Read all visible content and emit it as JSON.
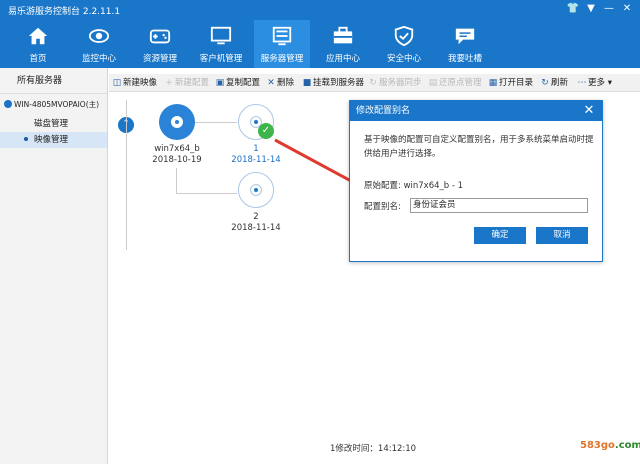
{
  "window": {
    "title": "易乐游服务控制台 2.2.11.1"
  },
  "nav": {
    "items": [
      {
        "label": "首页",
        "icon": "home-icon"
      },
      {
        "label": "监控中心",
        "icon": "eye-icon"
      },
      {
        "label": "资源管理",
        "icon": "gamepad-icon"
      },
      {
        "label": "客户机管理",
        "icon": "monitor-icon"
      },
      {
        "label": "服务器管理",
        "icon": "server-icon"
      },
      {
        "label": "应用中心",
        "icon": "toolbox-icon"
      },
      {
        "label": "安全中心",
        "icon": "shield-icon"
      },
      {
        "label": "我要吐槽",
        "icon": "chat-icon"
      }
    ],
    "active_index": 4
  },
  "sidebar": {
    "header": "所有服务器",
    "server": "WIN-4805MVOPAIO(主)",
    "items": [
      "磁盘管理",
      "映像管理"
    ],
    "selected": "映像管理"
  },
  "toolbar": {
    "new_image": "新建映像",
    "new_config": "新建配置",
    "copy_config": "复制配置",
    "delete": "删除",
    "mount": "挂载到服务器",
    "sync": "服务器同步",
    "restore_point": "还原点管理",
    "open_dir": "打开目录",
    "refresh": "刷新",
    "more": "更多"
  },
  "tree": {
    "root": {
      "name": "win7x64_b",
      "date": "2018-10-19"
    },
    "config1": {
      "name": "1",
      "date": "2018-11-14"
    },
    "config2": {
      "name": "2",
      "date": "2018-11-14"
    }
  },
  "dialog": {
    "title": "修改配置别名",
    "description": "基于映像的配置可自定义配置别名，用于多系统菜单启动时提供给用户进行选择。",
    "current_label": "原始配置:",
    "current_value": "win7x64_b - 1",
    "alias_label": "配置别名:",
    "alias_value": "身份证会员",
    "ok": "确定",
    "cancel": "取消"
  },
  "status": {
    "text": "1修改时间：14:12:10"
  },
  "watermark": {
    "text": "583go",
    "tld": ".com"
  },
  "colors": {
    "primary": "#1976c9",
    "active_nav": "#2b8ee0",
    "arrow": "#e03a2f",
    "check": "#3db54a"
  }
}
